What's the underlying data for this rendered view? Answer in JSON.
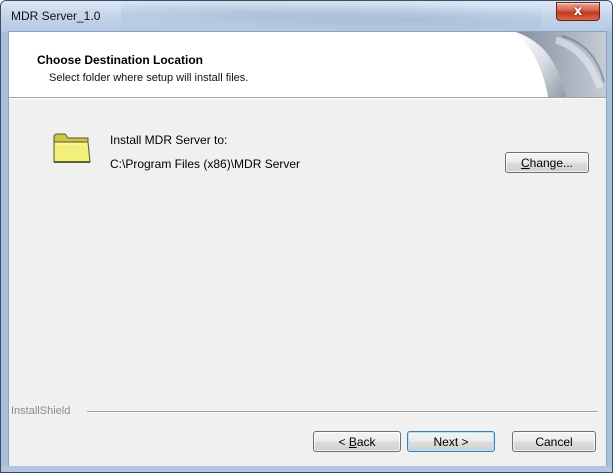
{
  "window": {
    "title": "MDR Server_1.0",
    "close_glyph": "x"
  },
  "header": {
    "title": "Choose Destination Location",
    "subtitle": "Select folder where setup will install files."
  },
  "destination": {
    "label": "Install MDR Server to:",
    "path": "C:\\Program Files (x86)\\MDR Server",
    "change_button": {
      "mnemonic": "C",
      "rest": "hange..."
    }
  },
  "footer": {
    "brand": "InstallShield",
    "back_button": {
      "prefix": "< ",
      "mnemonic": "B",
      "rest": "ack"
    },
    "next_button": "Next >",
    "cancel_button": "Cancel"
  },
  "icons": {
    "folder": "folder-icon",
    "close": "close-icon",
    "curl": "page-curl-graphic"
  },
  "colors": {
    "folder_fill": "#f2f07a",
    "folder_dark": "#b8b63a",
    "close_red": "#c0391f",
    "frame_blue": "#b4c8e0"
  }
}
